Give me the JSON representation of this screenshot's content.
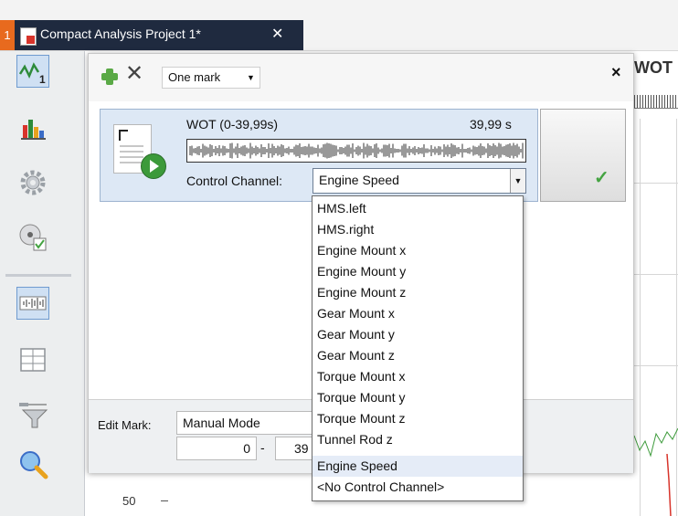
{
  "tab": {
    "number": "1",
    "title": "Compact Analysis Project 1*",
    "close_glyph": "✕"
  },
  "toolbar_left": {
    "icons": [
      "signal-analysis-icon",
      "bar-chart-icon",
      "gear-icon",
      "disk-check-icon",
      "waveform-icon",
      "table-grid-icon",
      "filter-icon",
      "search-icon"
    ],
    "selected": [
      "signal-analysis-icon",
      "waveform-icon"
    ]
  },
  "panel": {
    "add_glyph": "+",
    "delete_glyph": "✕",
    "mark_mode": "One mark",
    "close_glyph": "×",
    "mark": {
      "title": "WOT (0-39,99s)",
      "duration": "39,99 s",
      "control_channel_label": "Control Channel:",
      "control_channel_value": "Engine Speed"
    },
    "edit": {
      "label": "Edit Mark:",
      "mode": "Manual Mode",
      "start": "0",
      "dash": "-",
      "end": "39"
    }
  },
  "background": {
    "header_text": "WOT",
    "y_tick": "50"
  },
  "dropdown": {
    "items": [
      "HMS.left",
      "HMS.right",
      "Engine Mount x",
      "Engine Mount y",
      "Engine Mount z",
      "Gear Mount x",
      "Gear Mount y",
      "Gear Mount z",
      "Torque Mount x",
      "Torque Mount y",
      "Torque Mount z",
      "Tunnel Rod z",
      "Engine Speed",
      "<No Control Channel>"
    ],
    "highlighted": "Engine Speed"
  },
  "colors": {
    "tab_bg": "#1f2a3f",
    "tab_number_bg": "#e86a1e",
    "accent_green": "#44a341",
    "selection_blue": "#dde8f5"
  }
}
